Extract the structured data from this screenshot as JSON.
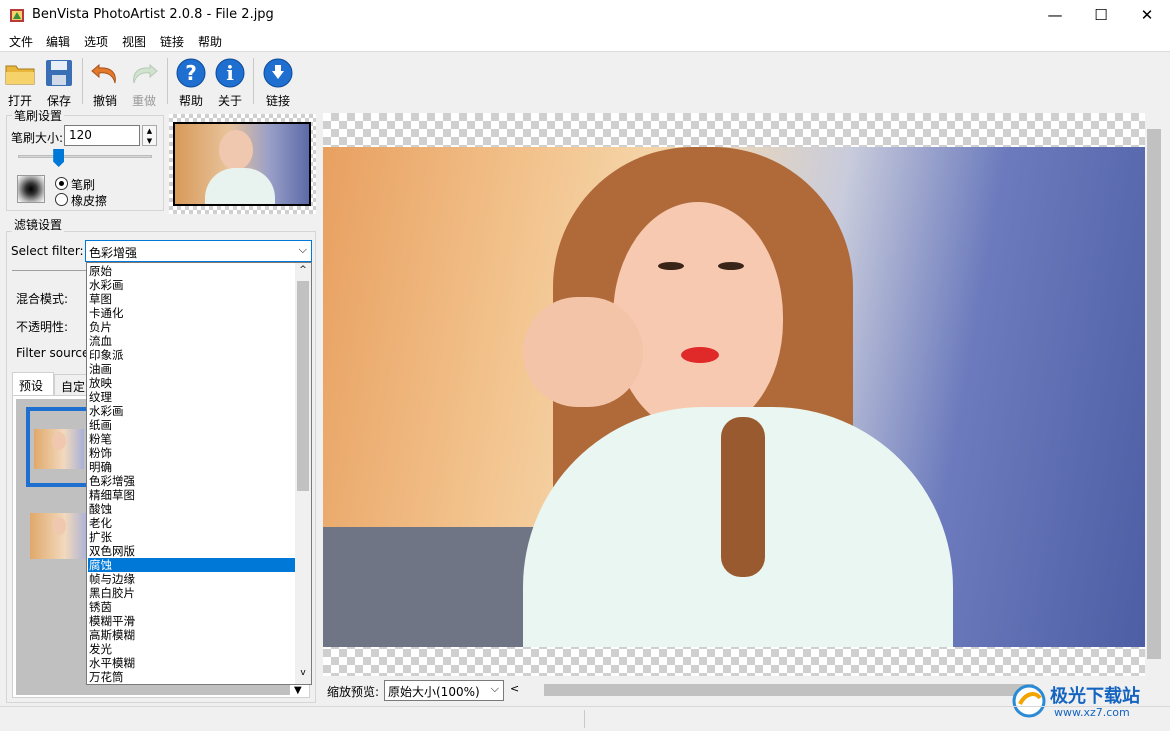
{
  "window": {
    "title": "BenVista PhotoArtist 2.0.8 - File 2.jpg",
    "minimize": "—",
    "maximize": "☐",
    "close": "✕"
  },
  "menu": [
    "文件",
    "编辑",
    "选项",
    "视图",
    "链接",
    "帮助"
  ],
  "toolbar": {
    "open": "打开",
    "save": "保存",
    "undo": "撤销",
    "redo": "重做",
    "help": "帮助",
    "about": "关于",
    "link": "链接"
  },
  "brush": {
    "group_title": "笔刷设置",
    "size_label": "笔刷大小:",
    "size_value": "120",
    "size_slider_fraction": 0.3,
    "option_brush": "笔刷",
    "option_eraser": "橡皮擦",
    "selected": "笔刷"
  },
  "filter": {
    "group_title": "滤镜设置",
    "select_label": "Select filter:",
    "selected_value": "色彩增强",
    "blend_label": "混合模式:",
    "opacity_label": "不透明性:",
    "source_label": "Filter source:",
    "tab_preset": "预设",
    "tab_custom": "自定",
    "options": [
      "原始",
      "水彩画",
      "草图",
      "卡通化",
      "负片",
      "流血",
      "印象派",
      "油画",
      "放映",
      "纹理",
      "水彩画",
      "纸画",
      "粉笔",
      "粉饰",
      "明确",
      "色彩增强",
      "精细草图",
      "酸蚀",
      "老化",
      "扩张",
      "双色网版",
      "腐蚀",
      "帧与边缘",
      "黑白胶片",
      "锈茵",
      "模糊平滑",
      "高斯模糊",
      "发光",
      "水平模糊",
      "万花筒"
    ],
    "highlighted_option": "腐蚀"
  },
  "zoom": {
    "label": "缩放预览:",
    "value": "原始大小(100%)"
  },
  "watermark": {
    "text": "极光下载站",
    "url": "www.xz7.com"
  },
  "colors": {
    "accent": "#0078d7",
    "icon_blue": "#1e6fd0"
  }
}
